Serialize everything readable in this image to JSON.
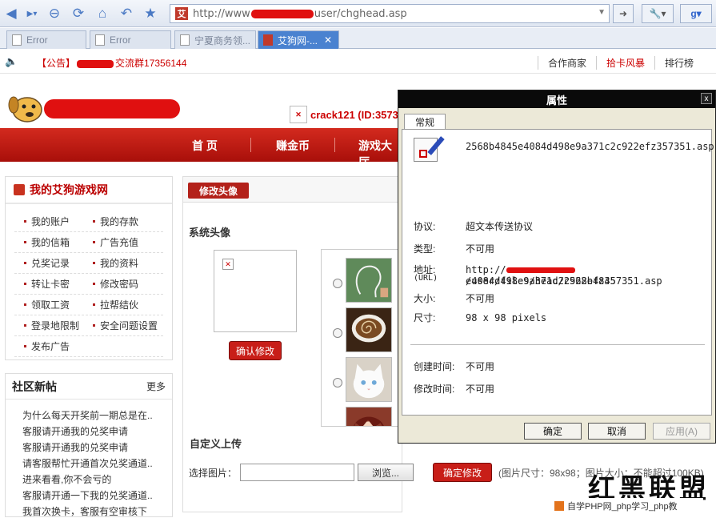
{
  "browser": {
    "url_prefix": "http://www",
    "url_suffix": "user/chghead.asp",
    "favicon_text": "艾",
    "google_letter": "g"
  },
  "tabs": [
    {
      "label": "Error"
    },
    {
      "label": "Error"
    },
    {
      "label": "宁夏商务领..."
    },
    {
      "label": "艾狗网-..."
    }
  ],
  "notice": {
    "prefix": "【公告】",
    "suffix": "交流群17356144",
    "links": [
      "合作商家",
      "拾卡风暴",
      "排行榜"
    ]
  },
  "user": {
    "name": "crack121 (ID:3573"
  },
  "nav": [
    "首 页",
    "赚金币",
    "游戏大厅"
  ],
  "left_menu": {
    "title": "我的艾狗游戏网",
    "items": [
      [
        "我的账户",
        "我的存款"
      ],
      [
        "我的信箱",
        "广告充值"
      ],
      [
        "兑奖记录",
        "我的资料"
      ],
      [
        "转让卡密",
        "修改密码"
      ],
      [
        "领取工资",
        "拉帮结伙"
      ],
      [
        "登录地限制",
        "安全问题设置"
      ],
      [
        "发布广告",
        ""
      ]
    ]
  },
  "community": {
    "title": "社区新帖",
    "more": "更多",
    "posts": [
      "为什么每天开奖前一期总是在..",
      "客服请开通我的兑奖申请",
      "客服请开通我的兑奖申请",
      "请客服帮忙开通首次兑奖通道..",
      "进来看看,你不会亏的",
      "客服请开通一下我的兑奖通道..",
      "我首次换卡，客服有空审核下"
    ]
  },
  "main": {
    "tab": "修改头像",
    "system_avatar": "系统头像",
    "confirm": "确认修改",
    "custom_upload": "自定义上传",
    "select_image": "选择图片：",
    "browse": "浏览...",
    "submit": "确定修改",
    "hint": "(图片尺寸：98x98；图片大小：不能超过100KB)"
  },
  "dialog": {
    "title": "属性",
    "close": "x",
    "tab": "常规",
    "filename": "2568b4845e4084d498e9a371c2c922efz357351.asp",
    "protocol_k": "协议:",
    "protocol_v": "超文本传送协议",
    "type_k": "类型:",
    "type_v": "不可用",
    "addr_k": "地址:",
    "addr_k2": "(URL)",
    "addr_v1a": "http://",
    "addr_v1b": "/user/files/head/2568b4845",
    "addr_v2": "e4084d498e9a371c2c922efz357351.asp",
    "size_k": "大小:",
    "size_v": "不可用",
    "dim_k": "尺寸:",
    "dim_v": "98  x  98  pixels",
    "created_k": "创建时间:",
    "created_v": "不可用",
    "modified_k": "修改时间:",
    "modified_v": "不可用",
    "ok": "确定",
    "cancel": "取消",
    "apply": "应用(A)"
  },
  "watermark": {
    "main": "红黑联盟",
    "sub": "自学PHP网_php学习_php教"
  }
}
